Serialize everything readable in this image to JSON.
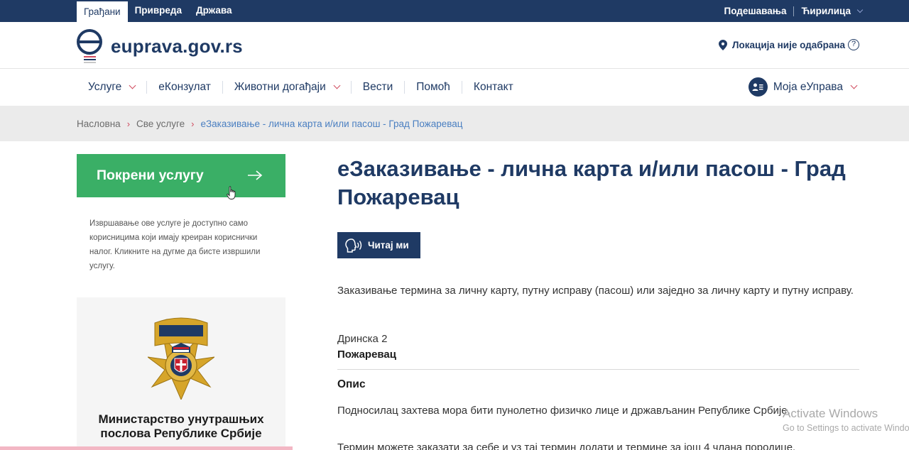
{
  "topbar": {
    "tabs": [
      "Грађани",
      "Привреда",
      "Држава"
    ],
    "settings": "Подешавања",
    "script": "Ћирилица"
  },
  "header": {
    "logo_text": "euprava.gov.rs",
    "location": "Локација није одабрана",
    "help": "?"
  },
  "nav": {
    "items": [
      "Услуге",
      "еКонзулат",
      "Животни догађаји",
      "Вести",
      "Помоћ",
      "Контакт"
    ],
    "account": "Моја еУправа"
  },
  "breadcrumb": {
    "items": [
      "Насловна",
      "Све услуге"
    ],
    "current": "еЗаказивање - лична карта и/или пасош - Град Пожаревац"
  },
  "sidebar": {
    "start_label": "Покрени услугу",
    "note": "Извршавање ове услуге је доступно само корисницима који имају креиран кориснички налог. Кликните на дугме да бисте извршили услугу.",
    "ministry_name": "Министарство унутрашњих послова Републике Србије"
  },
  "main": {
    "title": "еЗаказивање - лична карта и/или пасош - Град Пожаревац",
    "read_label": "Читај ми",
    "intro": "Заказивање термина за личну карту, путну исправу (пасош) или заједно за личну карту и путну исправу.",
    "address": "Дринска 2",
    "city": "Пожаревац",
    "desc_title": "Опис",
    "desc_p1": "Подносилац захтева мора бити пунолетно физичко лице и држављанин Републике Србије.",
    "desc_p2": "Термин можете заказати за себе и уз тај термин додати и термине за још 4 члана породице."
  },
  "watermark": {
    "line1": "Activate Windows",
    "line2": "Go to Settings to activate Windows."
  },
  "colors": {
    "navy": "#1f3a64",
    "green": "#3aaf66",
    "accent_red": "#d04b5e",
    "link_blue": "#4a7fc1"
  }
}
